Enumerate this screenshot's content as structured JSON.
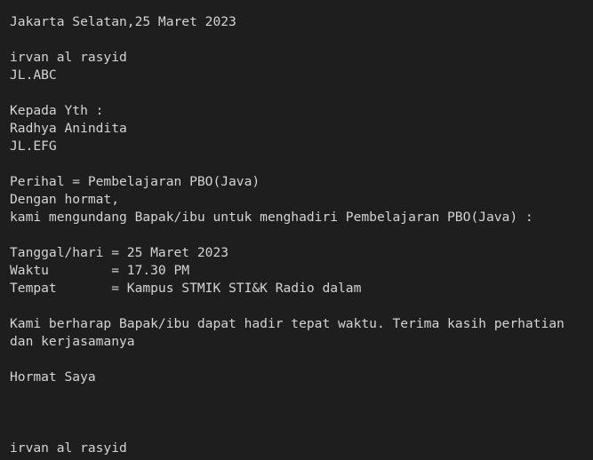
{
  "letter": {
    "place_date": "Jakarta Selatan,25 Maret 2023",
    "sender_name": "irvan al rasyid",
    "sender_address": "JL.ABC",
    "to_label": "Kepada Yth :",
    "recipient_name": "Radhya Anindita",
    "recipient_address": "JL.EFG",
    "subject": "Perihal = Pembelajaran PBO(Java)",
    "greeting": "Dengan hormat,",
    "invitation": "kami mengundang Bapak/ibu untuk menghadiri Pembelajaran PBO(Java) :",
    "date_line": "Tanggal/hari = 25 Maret 2023",
    "time_line": "Waktu        = 17.30 PM",
    "place_line": "Tempat       = Kampus STMIK STI&K Radio dalam",
    "closing_1": "Kami berharap Bapak/ibu dapat hadir tepat waktu. Terima kasih perhatian",
    "closing_2": "dan kerjasamanya",
    "regards": "Hormat Saya",
    "signature_name": "irvan al rasyid"
  }
}
